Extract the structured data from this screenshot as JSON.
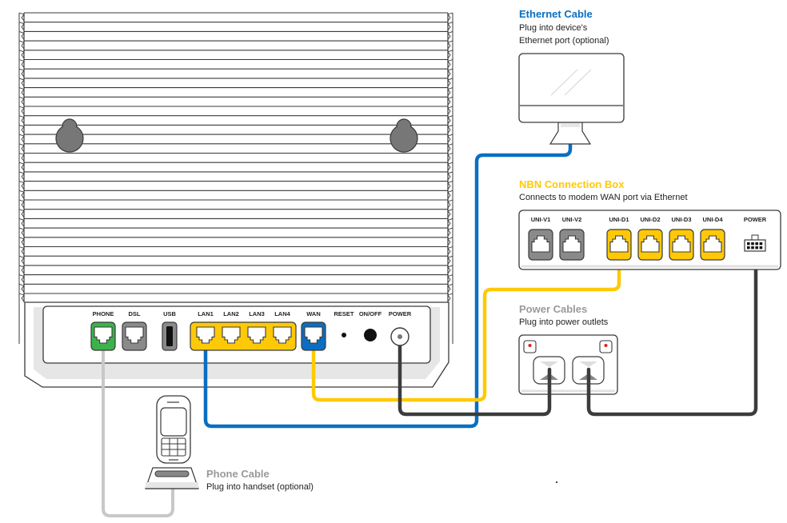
{
  "colors": {
    "ethernet": "#0A6FC2",
    "nbn": "#FFC907",
    "phone_green": "#3BB34A",
    "port_grey": "#8A8A8A",
    "phone_cable": "#C8C8C8",
    "power_cable": "#3C3C3C",
    "power_title": "#9A9A9A",
    "outline": "#3A3A3A",
    "panel_fill": "#E6E6E6",
    "indicator_red": "#E02020"
  },
  "labels": {
    "ethernet": {
      "title": "Ethernet Cable",
      "line1": "Plug into device's",
      "line2": "Ethernet port (optional)"
    },
    "nbn": {
      "title": "NBN Connection Box",
      "line1": "Connects to modem WAN port via Ethernet"
    },
    "power": {
      "title": "Power Cables",
      "line1": "Plug into power outlets"
    },
    "phone": {
      "title": "Phone Cable",
      "line1": "Plug into handset (optional)"
    }
  },
  "modem": {
    "ports": [
      {
        "id": "phone",
        "label": "PHONE",
        "type": "rj11",
        "color": "green"
      },
      {
        "id": "dsl",
        "label": "DSL",
        "type": "rj11",
        "color": "grey"
      },
      {
        "id": "usb",
        "label": "USB",
        "type": "usb",
        "color": "grey"
      },
      {
        "id": "lan1",
        "label": "LAN1",
        "type": "rj45",
        "color": "yellow"
      },
      {
        "id": "lan2",
        "label": "LAN2",
        "type": "rj45",
        "color": "yellow"
      },
      {
        "id": "lan3",
        "label": "LAN3",
        "type": "rj45",
        "color": "yellow"
      },
      {
        "id": "lan4",
        "label": "LAN4",
        "type": "rj45",
        "color": "yellow"
      },
      {
        "id": "wan",
        "label": "WAN",
        "type": "rj45",
        "color": "blue"
      },
      {
        "id": "reset",
        "label": "RESET",
        "type": "pinhole"
      },
      {
        "id": "onoff",
        "label": "ON/OFF",
        "type": "button"
      },
      {
        "id": "power",
        "label": "POWER",
        "type": "dc"
      }
    ]
  },
  "nbn_box": {
    "ports": [
      {
        "id": "uni-v1",
        "label": "UNI-V1",
        "color": "grey"
      },
      {
        "id": "uni-v2",
        "label": "UNI-V2",
        "color": "grey"
      },
      {
        "id": "uni-d1",
        "label": "UNI-D1",
        "color": "yellow"
      },
      {
        "id": "uni-d2",
        "label": "UNI-D2",
        "color": "yellow"
      },
      {
        "id": "uni-d3",
        "label": "UNI-D3",
        "color": "yellow"
      },
      {
        "id": "uni-d4",
        "label": "UNI-D4",
        "color": "yellow"
      },
      {
        "id": "power",
        "label": "POWER",
        "color": "none"
      }
    ]
  },
  "connections": [
    {
      "cable": "ethernet",
      "from": "LAN1",
      "to": "Computer"
    },
    {
      "cable": "nbn",
      "from": "WAN",
      "to": "UNI-D1"
    },
    {
      "cable": "power",
      "from": "Modem POWER",
      "to": "Power outlet 1"
    },
    {
      "cable": "power",
      "from": "NBN POWER",
      "to": "Power outlet 2"
    },
    {
      "cable": "phone",
      "from": "PHONE",
      "to": "Handset base"
    }
  ]
}
